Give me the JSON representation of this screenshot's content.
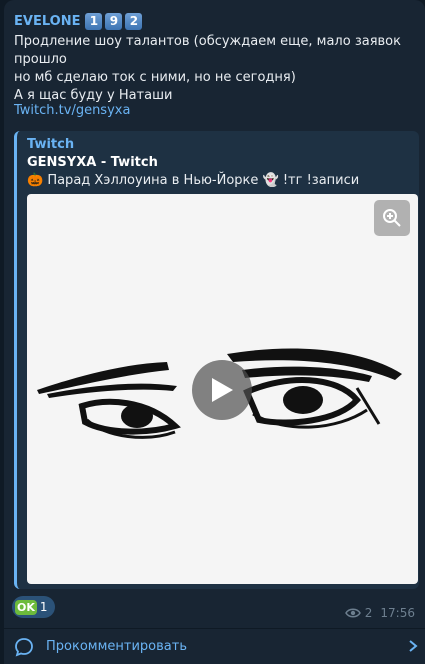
{
  "post": {
    "author": "EVELONE",
    "author_badges": [
      "1",
      "9",
      "2"
    ],
    "lines": [
      "Продление шоу талантов (обсуждаем еще, мало заявок прошло",
      "но мб сделаю ток с ними, но не сегодня)",
      "А я щас буду у Наташи"
    ],
    "link": "Twitch.tv/gensyxa"
  },
  "preview": {
    "site": "Twitch",
    "title": "GENSYXA - Twitch",
    "description": "🎃 Парад Хэллоуина в Нью-Йорке 👻 !тг !записи"
  },
  "footer": {
    "reaction_emoji": "OK",
    "reaction_count": "1",
    "views": "2",
    "time": "17:56"
  },
  "comments": {
    "label": "Прокомментировать"
  },
  "colors": {
    "accent": "#6ab3f3",
    "bubble": "#182533",
    "background": "#0f1a25",
    "reaction_bg": "#2b5278"
  }
}
